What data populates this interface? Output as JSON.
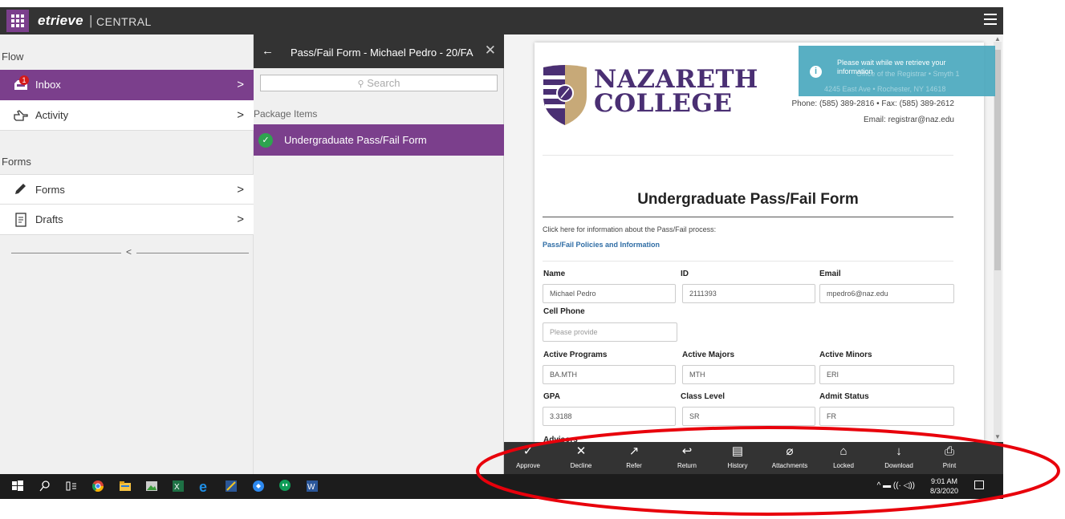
{
  "app": {
    "brand": "etrieve",
    "brand_sep": "|",
    "brand_sub": "CENTRAL"
  },
  "sidebar": {
    "flow_label": "Flow",
    "inbox": {
      "label": "Inbox",
      "badge": "1"
    },
    "activity": {
      "label": "Activity"
    },
    "forms_label": "Forms",
    "forms": {
      "label": "Forms"
    },
    "drafts": {
      "label": "Drafts"
    },
    "chevron": ">",
    "collapse": "<"
  },
  "package": {
    "back": "←",
    "title": "Pass/Fail Form - Michael Pedro - 20/FA",
    "close": "✕",
    "search_placeholder": "Search",
    "items_label": "Package Items",
    "items": [
      {
        "label": "Undergraduate Pass/Fail Form"
      }
    ]
  },
  "toast": {
    "message": "Please wait while we retrieve your information",
    "ghost_lines": [
      "Office of the Registrar • Smyth 1",
      "4245 East Ave • Rochester, NY 14618"
    ]
  },
  "college": {
    "name_line1": "NAZARETH",
    "name_line2": "COLLEGE",
    "phone": "Phone: (585) 389-2816 • Fax: (585) 389-2612",
    "email": "Email: registrar@naz.edu",
    "colors": {
      "purple": "#4a2f73",
      "gold": "#c7a978"
    }
  },
  "form": {
    "title": "Undergraduate Pass/Fail Form",
    "info_text": "Click here for information about the Pass/Fail process:",
    "info_link": "Pass/Fail Policies and Information",
    "fields": {
      "name": {
        "label": "Name",
        "value": "Michael Pedro"
      },
      "id": {
        "label": "ID",
        "value": "2111393"
      },
      "email": {
        "label": "Email",
        "value": "mpedro6@naz.edu"
      },
      "cell": {
        "label": "Cell Phone",
        "placeholder": "Please provide"
      },
      "programs": {
        "label": "Active Programs",
        "value": "BA.MTH"
      },
      "majors": {
        "label": "Active Majors",
        "value": "MTH"
      },
      "minors": {
        "label": "Active Minors",
        "value": "ERI"
      },
      "gpa": {
        "label": "GPA",
        "value": "3.3188"
      },
      "class_level": {
        "label": "Class Level",
        "value": "SR"
      },
      "admit_status": {
        "label": "Admit Status",
        "value": "FR"
      },
      "advisors": {
        "label": "Advisors"
      }
    }
  },
  "actions": [
    {
      "label": "Approve",
      "icon": "✓",
      "name": "approve"
    },
    {
      "label": "Decline",
      "icon": "✕",
      "name": "decline"
    },
    {
      "label": "Refer",
      "icon": "↗",
      "name": "refer"
    },
    {
      "label": "Return",
      "icon": "↩",
      "name": "return"
    },
    {
      "label": "History",
      "icon": "▤",
      "name": "history"
    },
    {
      "label": "Attachments",
      "icon": "⌀",
      "name": "attachments"
    },
    {
      "label": "Locked",
      "icon": "⌂",
      "name": "locked"
    },
    {
      "label": "Download",
      "icon": "↓",
      "name": "download"
    },
    {
      "label": "Print",
      "icon": "⎙",
      "name": "print"
    }
  ],
  "taskbar": {
    "tray": "^ ▬ ((· ◁))",
    "time": "9:01 AM",
    "date": "8/3/2020"
  },
  "annotation_color": "#e8000b"
}
